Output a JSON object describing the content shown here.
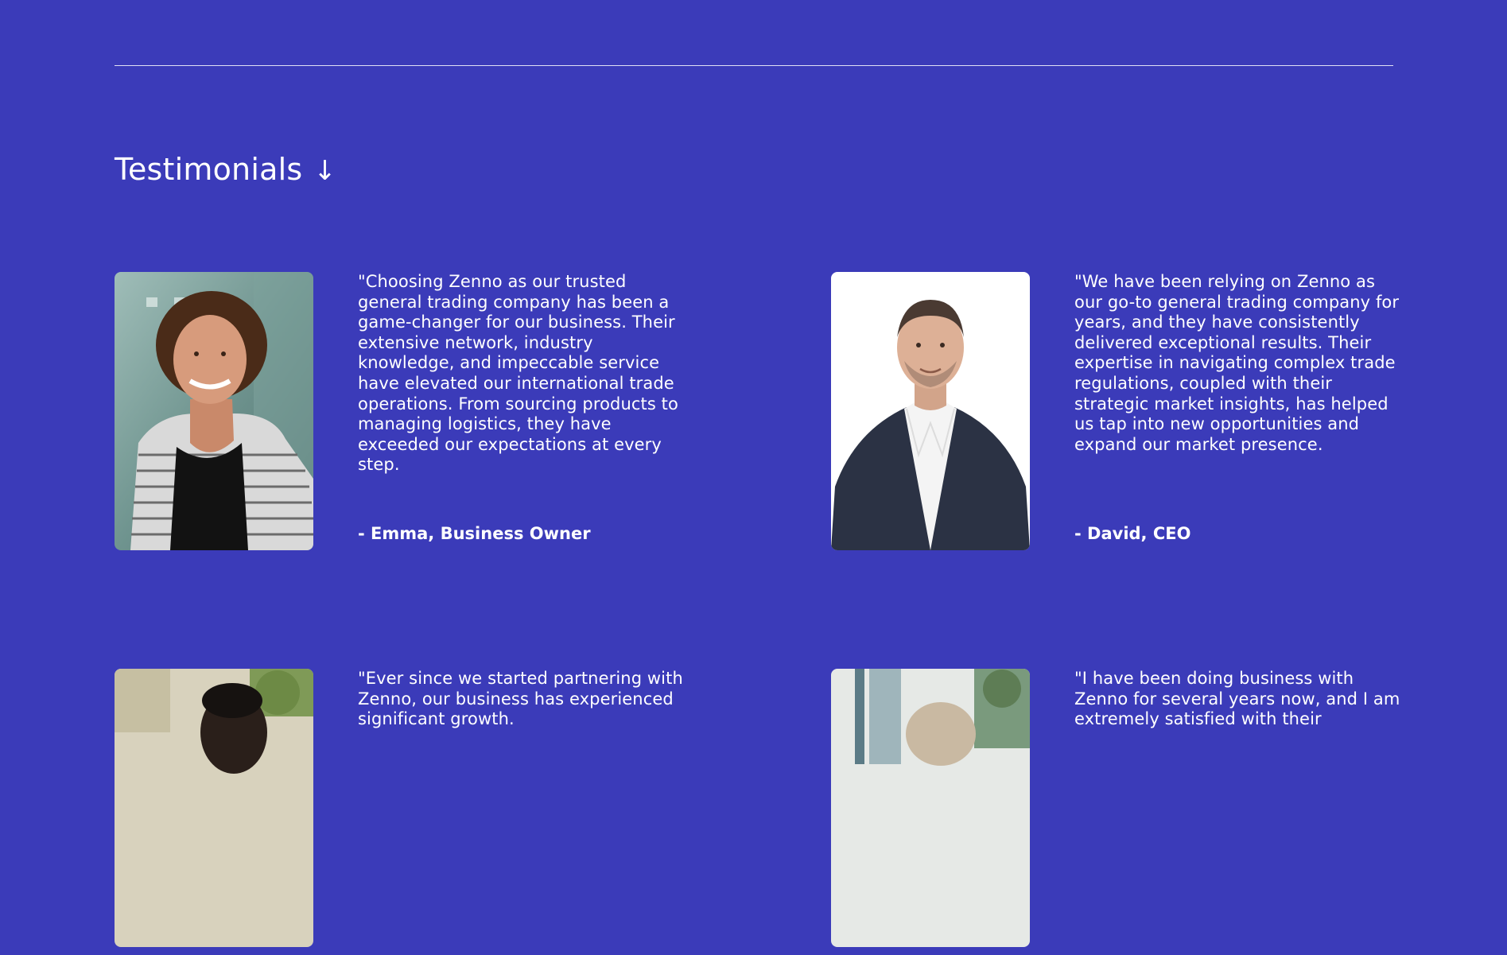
{
  "colors": {
    "background": "#3b3bb9",
    "text": "#ffffff"
  },
  "section": {
    "title": "Testimonials",
    "arrow_icon": "arrow-down-icon",
    "arrow_glyph": "↓"
  },
  "testimonials": [
    {
      "quote": "\"Choosing Zenno as our trusted general trading company has been a game-changer for our business. Their extensive network, industry knowledge, and impeccable service have elevated our international trade operations. From sourcing products to managing logistics, they have exceeded our expectations at every step.",
      "author": "- Emma, Business Owner"
    },
    {
      "quote": "\"We have been relying on Zenno as our go-to general trading company for years, and they have consistently delivered exceptional results. Their expertise in navigating complex trade regulations, coupled with their strategic market insights, has helped us tap into new opportunities and expand our market presence.",
      "author": "- David, CEO"
    },
    {
      "quote": "\"Ever since we started partnering with Zenno, our business has experienced significant growth.",
      "author": ""
    },
    {
      "quote": "\"I have been doing business with Zenno for several years now, and I am extremely satisfied with their",
      "author": ""
    }
  ]
}
